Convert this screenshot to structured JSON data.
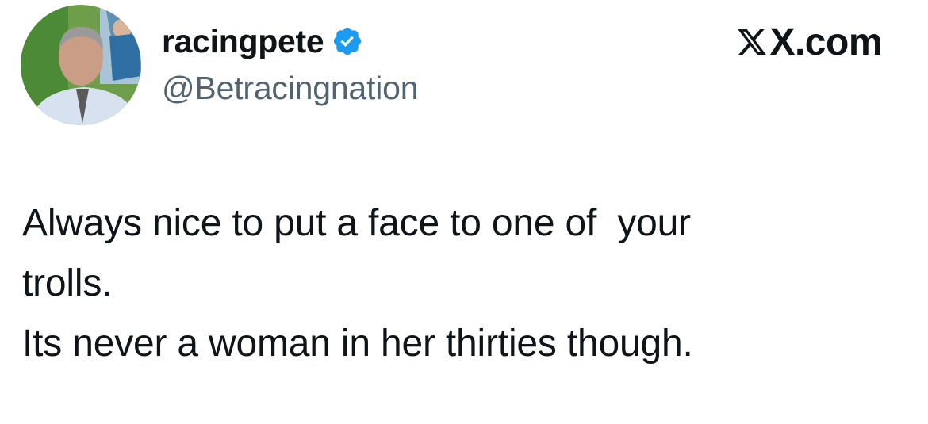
{
  "tweet": {
    "author": {
      "display_name": "racingpete",
      "handle": "@Betracingnation",
      "verified": true,
      "avatar_icon": "avatar-photo"
    },
    "brand": {
      "logo_icon": "x-logo-icon",
      "domain": "X.com"
    },
    "text_lines": [
      "Always nice to put a face to one of  your",
      "trolls.",
      "Its never a woman in her thirties though."
    ]
  },
  "colors": {
    "text_primary": "#0f1419",
    "text_secondary": "#536471",
    "verified_blue": "#1d9bf0",
    "background": "#ffffff"
  }
}
